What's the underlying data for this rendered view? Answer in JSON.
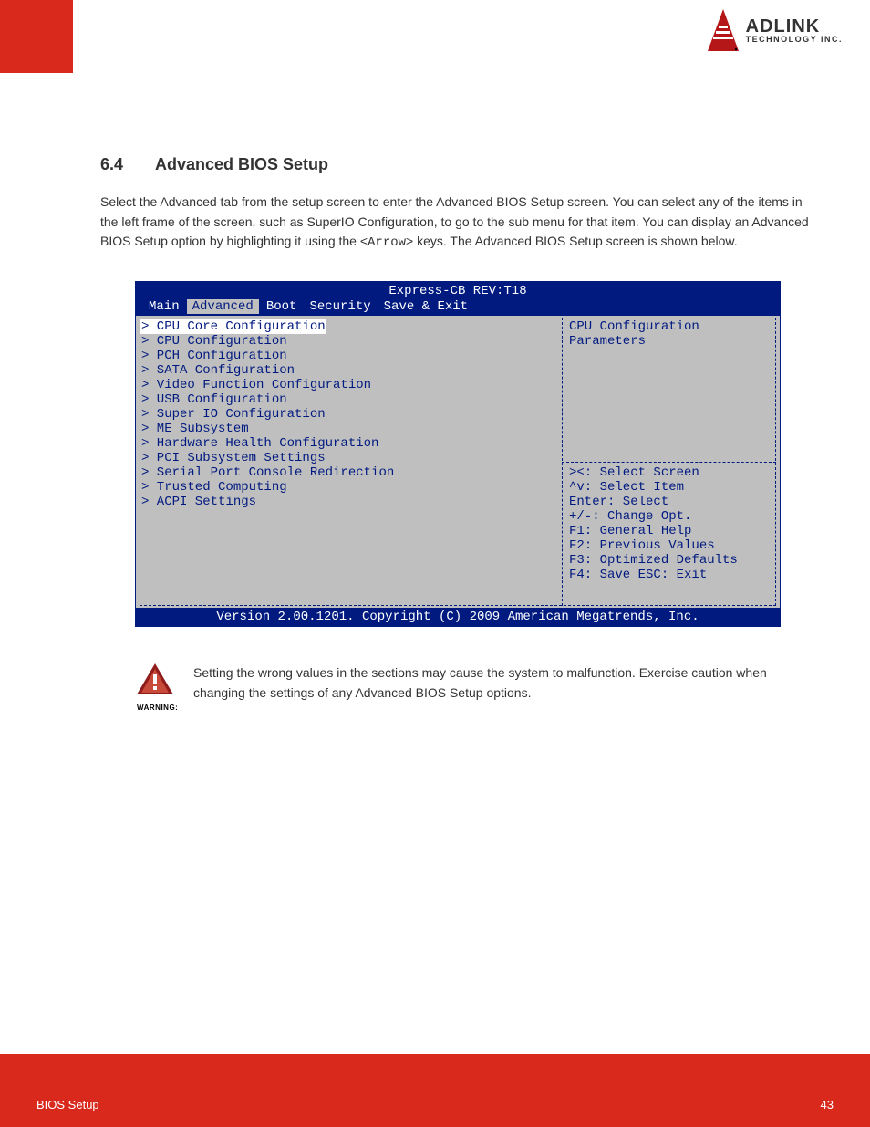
{
  "logo": {
    "name_line1": "ADLINK",
    "name_line2": "TECHNOLOGY INC."
  },
  "section": {
    "number": "6.4",
    "title": "Advanced BIOS Setup"
  },
  "intro": {
    "text_before_key": "Select the Advanced tab from the setup screen to enter the Advanced BIOS Setup screen. You can select any of the items in the left frame of the screen, such as SuperIO Configuration, to go to the sub menu for that item. You can display an Advanced BIOS Setup option by highlighting it using the <",
    "key": "Arrow",
    "text_after_key": "> keys. The Advanced BIOS Setup screen is shown below."
  },
  "bios": {
    "title": "Express-CB REV:T18",
    "menu": [
      "Main",
      "Advanced",
      "Boot",
      "Security",
      "Save & Exit"
    ],
    "menu_selected_index": 1,
    "left_items": [
      "CPU Core Configuration",
      "CPU Configuration",
      "PCH Configuration",
      "SATA Configuration",
      "Video Function Configuration",
      "USB Configuration",
      "Super IO Configuration",
      "ME Subsystem",
      "Hardware Health Configuration",
      "PCI Subsystem Settings",
      "Serial Port Console Redirection",
      "Trusted Computing",
      "ACPI Settings"
    ],
    "left_selected_index": 0,
    "right_desc": [
      "CPU Configuration",
      "Parameters"
    ],
    "help_lines": [
      "><: Select Screen",
      "^v: Select Item",
      "Enter: Select",
      "+/-: Change Opt.",
      "F1: General Help",
      "F2: Previous Values",
      "F3: Optimized Defaults",
      "F4: Save  ESC: Exit"
    ],
    "footer": "Version 2.00.1201. Copyright (C) 2009 American Megatrends, Inc."
  },
  "warning": {
    "caption": "WARNING:",
    "text": "Setting the wrong values in the sections may cause the system to malfunction. Exercise caution when changing the settings of any Advanced BIOS Setup options."
  },
  "footer": {
    "left": "BIOS Setup",
    "right": "43"
  }
}
